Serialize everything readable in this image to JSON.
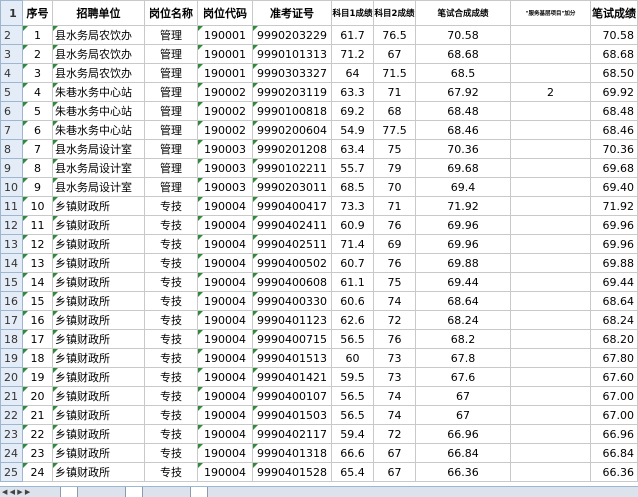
{
  "headers": {
    "seq": "序号",
    "unit": "招聘单位",
    "pos_name": "岗位名称",
    "pos_code": "岗位代码",
    "exam_no": "准考证号",
    "s1": "科目1成绩",
    "s2": "科目2成绩",
    "combined": "笔试合成成绩",
    "bonus": "\"服务基层项目\"加分",
    "final": "笔试成绩"
  },
  "row_numbers": [
    "1",
    "2",
    "3",
    "4",
    "5",
    "6",
    "7",
    "8",
    "9",
    "10",
    "11",
    "12",
    "13",
    "14",
    "15",
    "16",
    "17",
    "18",
    "19",
    "20",
    "21",
    "22",
    "23",
    "24",
    "25"
  ],
  "rows": [
    {
      "seq": "1",
      "unit": "县水务局农饮办",
      "pos": "管理",
      "code": "190001",
      "exam": "9990203229",
      "s1": "61.7",
      "s2": "76.5",
      "comb": "70.58",
      "bonus": "",
      "final": "70.58"
    },
    {
      "seq": "2",
      "unit": "县水务局农饮办",
      "pos": "管理",
      "code": "190001",
      "exam": "9990101313",
      "s1": "71.2",
      "s2": "67",
      "comb": "68.68",
      "bonus": "",
      "final": "68.68"
    },
    {
      "seq": "3",
      "unit": "县水务局农饮办",
      "pos": "管理",
      "code": "190001",
      "exam": "9990303327",
      "s1": "64",
      "s2": "71.5",
      "comb": "68.5",
      "bonus": "",
      "final": "68.50"
    },
    {
      "seq": "4",
      "unit": "朱巷水务中心站",
      "pos": "管理",
      "code": "190002",
      "exam": "9990203119",
      "s1": "63.3",
      "s2": "71",
      "comb": "67.92",
      "bonus": "2",
      "final": "69.92"
    },
    {
      "seq": "5",
      "unit": "朱巷水务中心站",
      "pos": "管理",
      "code": "190002",
      "exam": "9990100818",
      "s1": "69.2",
      "s2": "68",
      "comb": "68.48",
      "bonus": "",
      "final": "68.48"
    },
    {
      "seq": "6",
      "unit": "朱巷水务中心站",
      "pos": "管理",
      "code": "190002",
      "exam": "9990200604",
      "s1": "54.9",
      "s2": "77.5",
      "comb": "68.46",
      "bonus": "",
      "final": "68.46"
    },
    {
      "seq": "7",
      "unit": "县水务局设计室",
      "pos": "管理",
      "code": "190003",
      "exam": "9990201208",
      "s1": "63.4",
      "s2": "75",
      "comb": "70.36",
      "bonus": "",
      "final": "70.36"
    },
    {
      "seq": "8",
      "unit": "县水务局设计室",
      "pos": "管理",
      "code": "190003",
      "exam": "9990102211",
      "s1": "55.7",
      "s2": "79",
      "comb": "69.68",
      "bonus": "",
      "final": "69.68"
    },
    {
      "seq": "9",
      "unit": "县水务局设计室",
      "pos": "管理",
      "code": "190003",
      "exam": "9990203011",
      "s1": "68.5",
      "s2": "70",
      "comb": "69.4",
      "bonus": "",
      "final": "69.40"
    },
    {
      "seq": "10",
      "unit": "乡镇财政所",
      "pos": "专技",
      "code": "190004",
      "exam": "9990400417",
      "s1": "73.3",
      "s2": "71",
      "comb": "71.92",
      "bonus": "",
      "final": "71.92"
    },
    {
      "seq": "11",
      "unit": "乡镇财政所",
      "pos": "专技",
      "code": "190004",
      "exam": "9990402411",
      "s1": "60.9",
      "s2": "76",
      "comb": "69.96",
      "bonus": "",
      "final": "69.96"
    },
    {
      "seq": "12",
      "unit": "乡镇财政所",
      "pos": "专技",
      "code": "190004",
      "exam": "9990402511",
      "s1": "71.4",
      "s2": "69",
      "comb": "69.96",
      "bonus": "",
      "final": "69.96"
    },
    {
      "seq": "13",
      "unit": "乡镇财政所",
      "pos": "专技",
      "code": "190004",
      "exam": "9990400502",
      "s1": "60.7",
      "s2": "76",
      "comb": "69.88",
      "bonus": "",
      "final": "69.88"
    },
    {
      "seq": "14",
      "unit": "乡镇财政所",
      "pos": "专技",
      "code": "190004",
      "exam": "9990400608",
      "s1": "61.1",
      "s2": "75",
      "comb": "69.44",
      "bonus": "",
      "final": "69.44"
    },
    {
      "seq": "15",
      "unit": "乡镇财政所",
      "pos": "专技",
      "code": "190004",
      "exam": "9990400330",
      "s1": "60.6",
      "s2": "74",
      "comb": "68.64",
      "bonus": "",
      "final": "68.64"
    },
    {
      "seq": "16",
      "unit": "乡镇财政所",
      "pos": "专技",
      "code": "190004",
      "exam": "9990401123",
      "s1": "62.6",
      "s2": "72",
      "comb": "68.24",
      "bonus": "",
      "final": "68.24"
    },
    {
      "seq": "17",
      "unit": "乡镇财政所",
      "pos": "专技",
      "code": "190004",
      "exam": "9990400715",
      "s1": "56.5",
      "s2": "76",
      "comb": "68.2",
      "bonus": "",
      "final": "68.20"
    },
    {
      "seq": "18",
      "unit": "乡镇财政所",
      "pos": "专技",
      "code": "190004",
      "exam": "9990401513",
      "s1": "60",
      "s2": "73",
      "comb": "67.8",
      "bonus": "",
      "final": "67.80"
    },
    {
      "seq": "19",
      "unit": "乡镇财政所",
      "pos": "专技",
      "code": "190004",
      "exam": "9990401421",
      "s1": "59.5",
      "s2": "73",
      "comb": "67.6",
      "bonus": "",
      "final": "67.60"
    },
    {
      "seq": "20",
      "unit": "乡镇财政所",
      "pos": "专技",
      "code": "190004",
      "exam": "9990400107",
      "s1": "56.5",
      "s2": "74",
      "comb": "67",
      "bonus": "",
      "final": "67.00"
    },
    {
      "seq": "21",
      "unit": "乡镇财政所",
      "pos": "专技",
      "code": "190004",
      "exam": "9990401503",
      "s1": "56.5",
      "s2": "74",
      "comb": "67",
      "bonus": "",
      "final": "67.00"
    },
    {
      "seq": "22",
      "unit": "乡镇财政所",
      "pos": "专技",
      "code": "190004",
      "exam": "9990402117",
      "s1": "59.4",
      "s2": "72",
      "comb": "66.96",
      "bonus": "",
      "final": "66.96"
    },
    {
      "seq": "23",
      "unit": "乡镇财政所",
      "pos": "专技",
      "code": "190004",
      "exam": "9990401318",
      "s1": "66.6",
      "s2": "67",
      "comb": "66.84",
      "bonus": "",
      "final": "66.84"
    },
    {
      "seq": "24",
      "unit": "乡镇财政所",
      "pos": "专技",
      "code": "190004",
      "exam": "9990401528",
      "s1": "65.4",
      "s2": "67",
      "comb": "66.36",
      "bonus": "",
      "final": "66.36"
    }
  ],
  "colors": {
    "header_bg": "#e4ecf7",
    "grid": "#c9c9c9",
    "marker": "#2e8b3a"
  }
}
